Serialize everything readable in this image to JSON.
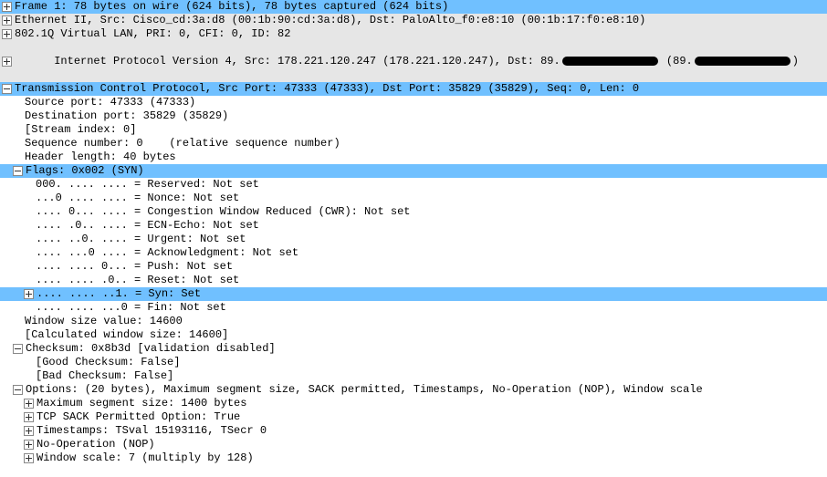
{
  "frame": {
    "summary": "Frame 1: 78 bytes on wire (624 bits), 78 bytes captured (624 bits)"
  },
  "eth": {
    "summary": "Ethernet II, Src: Cisco_cd:3a:d8 (00:1b:90:cd:3a:d8), Dst: PaloAlto_f0:e8:10 (00:1b:17:f0:e8:10)"
  },
  "vlan": {
    "summary": "802.1Q Virtual LAN, PRI: 0, CFI: 0, ID: 82"
  },
  "ip": {
    "prefix": "Internet Protocol Version 4, Src: 178.221.120.247 (178.221.120.247), Dst: 89.",
    "mid": " (89.",
    "suffix": ")"
  },
  "tcp": {
    "summary": "Transmission Control Protocol, Src Port: 47333 (47333), Dst Port: 35829 (35829), Seq: 0, Len: 0",
    "srcport": "Source port: 47333 (47333)",
    "dstport": "Destination port: 35829 (35829)",
    "stream": "[Stream index: 0]",
    "seq": "Sequence number: 0    (relative sequence number)",
    "hdrlen": "Header length: 40 bytes",
    "flags_summary": "Flags: 0x002 (SYN)",
    "flags": {
      "reserved": "000. .... .... = Reserved: Not set",
      "nonce": "...0 .... .... = Nonce: Not set",
      "cwr": ".... 0... .... = Congestion Window Reduced (CWR): Not set",
      "ecn": ".... .0.. .... = ECN-Echo: Not set",
      "urg": ".... ..0. .... = Urgent: Not set",
      "ack": ".... ...0 .... = Acknowledgment: Not set",
      "psh": ".... .... 0... = Push: Not set",
      "rst": ".... .... .0.. = Reset: Not set",
      "syn": ".... .... ..1. = Syn: Set",
      "fin": ".... .... ...0 = Fin: Not set"
    },
    "winsize": "Window size value: 14600",
    "calcwin": "[Calculated window size: 14600]",
    "cksum": "Checksum: 0x8b3d [validation disabled]",
    "goodck": "[Good Checksum: False]",
    "badck": "[Bad Checksum: False]",
    "options_summary": "Options: (20 bytes), Maximum segment size, SACK permitted, Timestamps, No-Operation (NOP), Window scale",
    "options": {
      "mss": "Maximum segment size: 1400 bytes",
      "sack": "TCP SACK Permitted Option: True",
      "ts": "Timestamps: TSval 15193116, TSecr 0",
      "nop": "No-Operation (NOP)",
      "ws": "Window scale: 7 (multiply by 128)"
    }
  }
}
